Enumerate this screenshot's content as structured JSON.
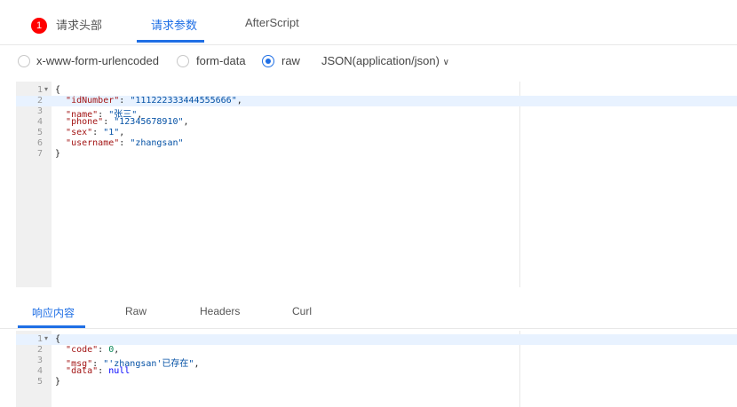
{
  "top_tabs": {
    "badge": "1",
    "headers": "请求头部",
    "params": "请求参数",
    "after": "AfterScript"
  },
  "body_types": {
    "urlencoded": "x-www-form-urlencoded",
    "formdata": "form-data",
    "raw": "raw",
    "selected": "raw",
    "json_select": "JSON(application/json)"
  },
  "request_editor": {
    "line_numbers": [
      "1",
      "2",
      "3",
      "4",
      "5",
      "6",
      "7"
    ],
    "lines": [
      {
        "p0": "{"
      },
      {
        "k": "\"idNumber\"",
        "sep": ": ",
        "v": "\"111222333444555666\"",
        "end": ","
      },
      {
        "k": "\"name\"",
        "sep": ": ",
        "v": "\"张三\"",
        "end": ","
      },
      {
        "k": "\"phone\"",
        "sep": ": ",
        "v": "\"12345678910\"",
        "end": ","
      },
      {
        "k": "\"sex\"",
        "sep": ": ",
        "v": "\"1\"",
        "end": ","
      },
      {
        "k": "\"username\"",
        "sep": ": ",
        "v": "\"zhangsan\"",
        "end": ""
      },
      {
        "p0": "}"
      }
    ]
  },
  "bottom_tabs": {
    "response": "响应内容",
    "raw": "Raw",
    "headers": "Headers",
    "curl": "Curl"
  },
  "response_editor": {
    "line_numbers": [
      "1",
      "2",
      "3",
      "4",
      "5"
    ],
    "lines": [
      {
        "p0": "{"
      },
      {
        "k": "\"code\"",
        "sep": ": ",
        "n": "0",
        "end": ","
      },
      {
        "k": "\"msg\"",
        "sep": ": ",
        "v": "\"'zhangsan'已存在\"",
        "end": ","
      },
      {
        "k": "\"data\"",
        "sep": ": ",
        "kw": "null",
        "end": ""
      },
      {
        "p0": "}"
      }
    ]
  }
}
